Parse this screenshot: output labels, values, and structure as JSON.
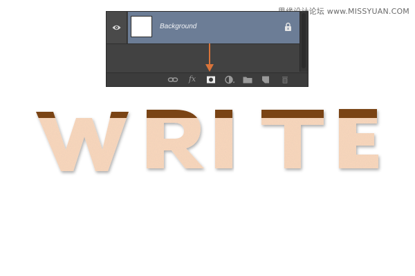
{
  "watermark": "思缘设计论坛 www.MISSYUAN.COM",
  "layers_panel": {
    "layer": {
      "name": "Background",
      "visible": true,
      "locked": true,
      "eye_icon": "eye-icon",
      "lock_icon": "lock-icon"
    },
    "toolbar": [
      {
        "name": "link-layers",
        "icon": "link-icon"
      },
      {
        "name": "layer-style",
        "icon": "fx-icon",
        "label": "fx"
      },
      {
        "name": "add-layer-mask",
        "icon": "mask-icon"
      },
      {
        "name": "new-adjustment-layer",
        "icon": "adjustment-icon"
      },
      {
        "name": "new-group",
        "icon": "folder-icon"
      },
      {
        "name": "new-layer",
        "icon": "new-layer-icon"
      },
      {
        "name": "delete-layer",
        "icon": "trash-icon"
      }
    ],
    "highlighted_button": "add-layer-mask"
  },
  "annotation": {
    "type": "arrow",
    "color": "#d9743a"
  },
  "artwork": {
    "text": "WRITE",
    "letters": [
      "W",
      "R",
      "I",
      "T",
      "E"
    ],
    "fill_color": "#f6d5bb",
    "cap_color": "#7a4415"
  }
}
